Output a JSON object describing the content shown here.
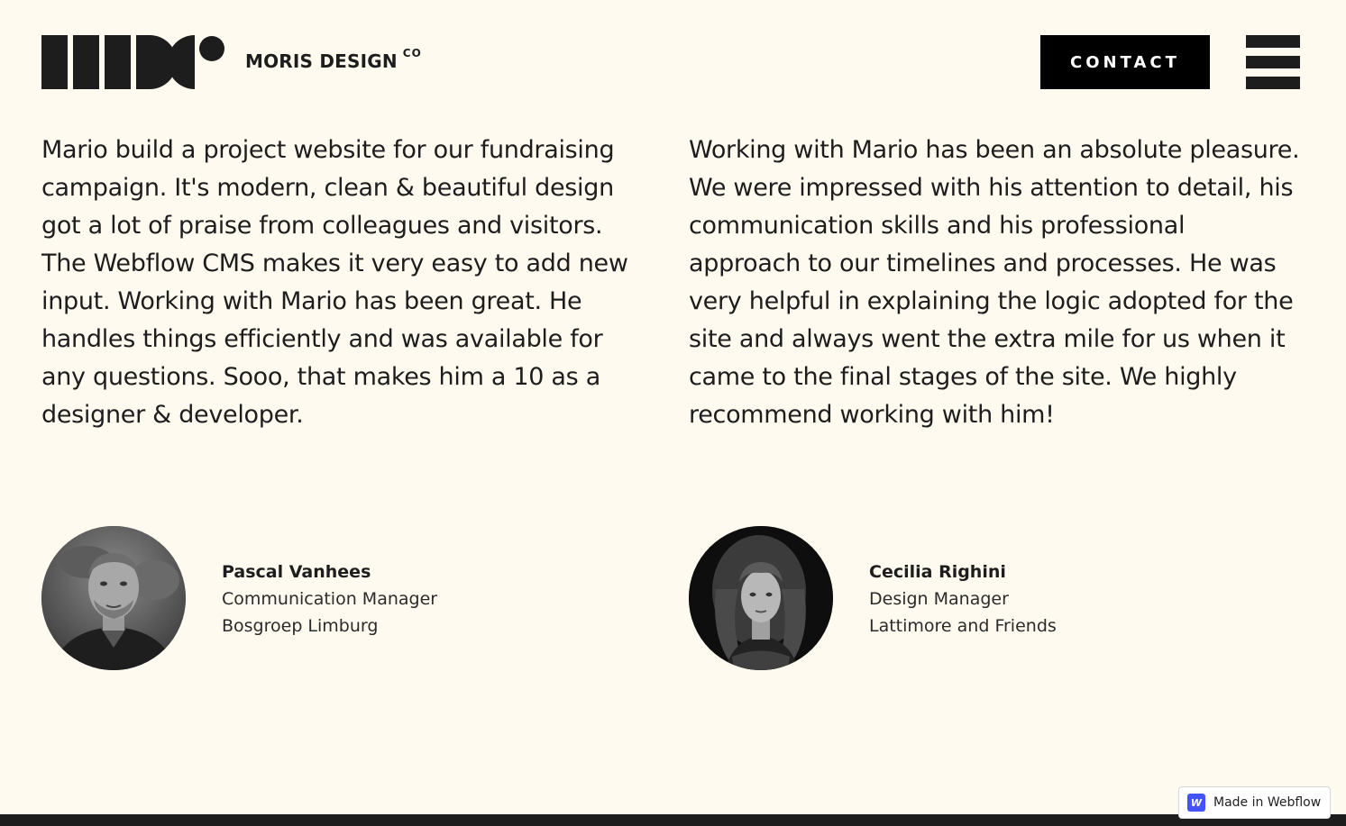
{
  "header": {
    "brand_name": "MORIS DESIGN",
    "brand_suffix": "CO",
    "contact_label": "CONTACT"
  },
  "testimonials": [
    {
      "quote": "Mario build a project website for our fundraising campaign. It's modern, clean & beautiful design got a lot of praise from colleagues and visitors. The Webflow CMS makes it very easy to add new input. Working with Mario has been great. He handles things efficiently and was available for any questions. Sooo, that makes him a 10 as a designer & developer.",
      "name": "Pascal Vanhees",
      "role": "Communication Manager",
      "company": "Bosgroep Limburg"
    },
    {
      "quote": "Working with Mario has been an absolute pleasure. We were impressed with his attention to detail, his communication skills and his professional approach to our timelines and processes. He was very helpful in explaining the logic adopted for the site and always went the extra mile for us when it came to the final stages of the site. We highly recommend working with him!",
      "name": "Cecilia Righini",
      "role": "Design Manager",
      "company": "Lattimore and Friends"
    }
  ],
  "badge": {
    "icon_letter": "W",
    "label": "Made in Webflow"
  },
  "colors": {
    "background": "#fefaef",
    "text": "#1d1d1d",
    "button": "#000000",
    "webflow_blue": "#4353ff"
  }
}
